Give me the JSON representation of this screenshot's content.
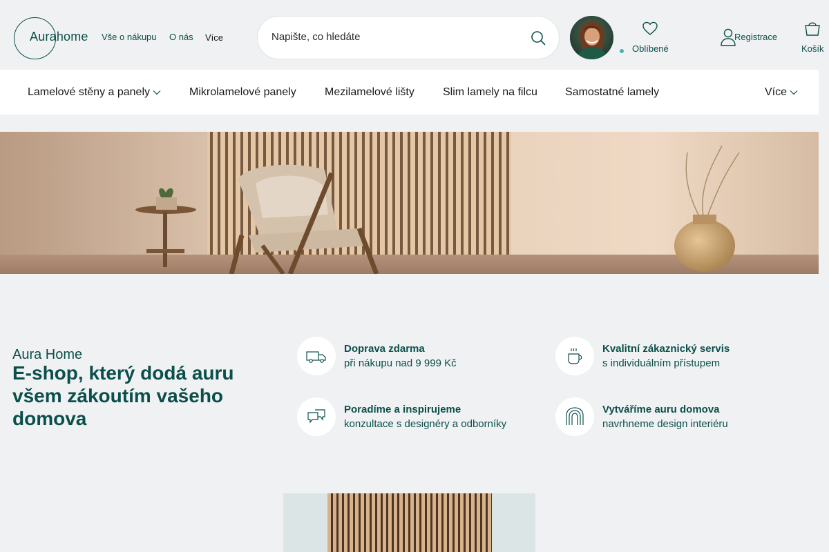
{
  "brand": {
    "logo_text": "Aurahome"
  },
  "top_nav": {
    "items": [
      "Vše o nákupu",
      "O nás"
    ],
    "more_label": "Více",
    "more_caret": ""
  },
  "search": {
    "placeholder": "Napište, co hledáte"
  },
  "account": {
    "favorites_label": "Oblíbené",
    "register_label": "Registrace",
    "cart_label": "Košík"
  },
  "categories": {
    "items": [
      "Lamelové stěny a panely",
      "Mikrolamelové panely",
      "Mezilamelové lišty",
      "Slim lamely na filcu",
      "Samostatné lamely"
    ],
    "more_label": "Více"
  },
  "intro": {
    "eyebrow": "Aura Home",
    "headline": "E-shop, který dodá auru všem zákoutím vašeho domova"
  },
  "features": [
    {
      "icon": "truck-icon",
      "title": "Doprava zdarma",
      "subtitle": "při nákupu nad 9 999 Kč"
    },
    {
      "icon": "cup-icon",
      "title": "Kvalitní zákaznický servis",
      "subtitle": "s individuálním přístupem"
    },
    {
      "icon": "chat-bubbles-icon",
      "title": "Poradíme a inspirujeme",
      "subtitle": "konzultace s designéry a odborníky"
    },
    {
      "icon": "arch-icon",
      "title": "Vytváříme auru domova",
      "subtitle": "navrhneme design interiéru"
    }
  ],
  "colors": {
    "brand": "#0b4f4a",
    "background": "#f0f1f3",
    "accent_dot": "#46b3ad"
  }
}
